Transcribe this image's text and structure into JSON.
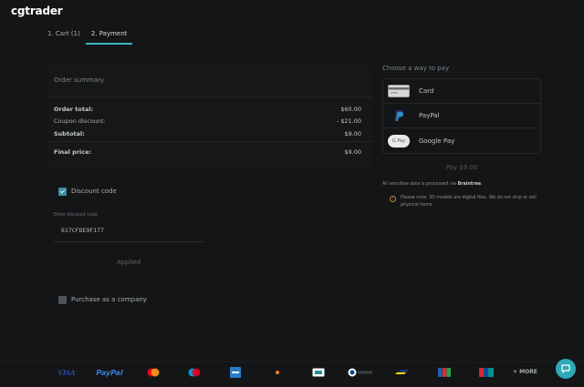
{
  "app": {
    "logo": "cgtrader"
  },
  "tabs": [
    {
      "label": "1. Cart (1)",
      "active": false
    },
    {
      "label": "2. Payment",
      "active": true
    }
  ],
  "order_summary": {
    "title": "Order summary",
    "rows": {
      "order_total": {
        "label": "Order total:",
        "value": "$60.00"
      },
      "coupon": {
        "label": "Coupon discount:",
        "value": "- $21.00"
      },
      "subtotal": {
        "label": "Subtotal:",
        "value": "$9.00"
      },
      "final": {
        "label": "Final price:",
        "value": "$9.00"
      }
    }
  },
  "discount": {
    "checkbox_label": "Discount code",
    "checked": true,
    "field_label": "Enter discount code",
    "value": "617CFDE9F177",
    "applied_label": "Applied"
  },
  "company": {
    "checkbox_label": "Purchase as a company",
    "checked": false
  },
  "payment": {
    "title": "Choose a way to pay",
    "options": [
      {
        "label": "Card",
        "icon": "credit-card-icon"
      },
      {
        "label": "PayPal",
        "icon": "paypal-icon"
      },
      {
        "label": "Google Pay",
        "icon": "google-pay-icon",
        "icon_text": "G Pay"
      }
    ],
    "pay_button": "Pay $9.00",
    "secure_prefix": "All sensitive data is processed via ",
    "secure_provider": "Braintree",
    "secure_suffix": ".",
    "note": "Please note: 3D models are digital files. We do not ship or sell physical items."
  },
  "footer": {
    "brands": [
      "VISA",
      "PayPal",
      "mastercard",
      "maestro",
      "amex",
      "discover",
      "cash",
      "diners",
      "bancontact",
      "jcb",
      "unionpay"
    ],
    "visa_text": "VISA",
    "paypal_text": "PayPal",
    "more_label": "+ MORE"
  },
  "colors": {
    "accent": "#35b5c7",
    "background": "#141516",
    "checkbox_on": "#3d8fa0"
  }
}
